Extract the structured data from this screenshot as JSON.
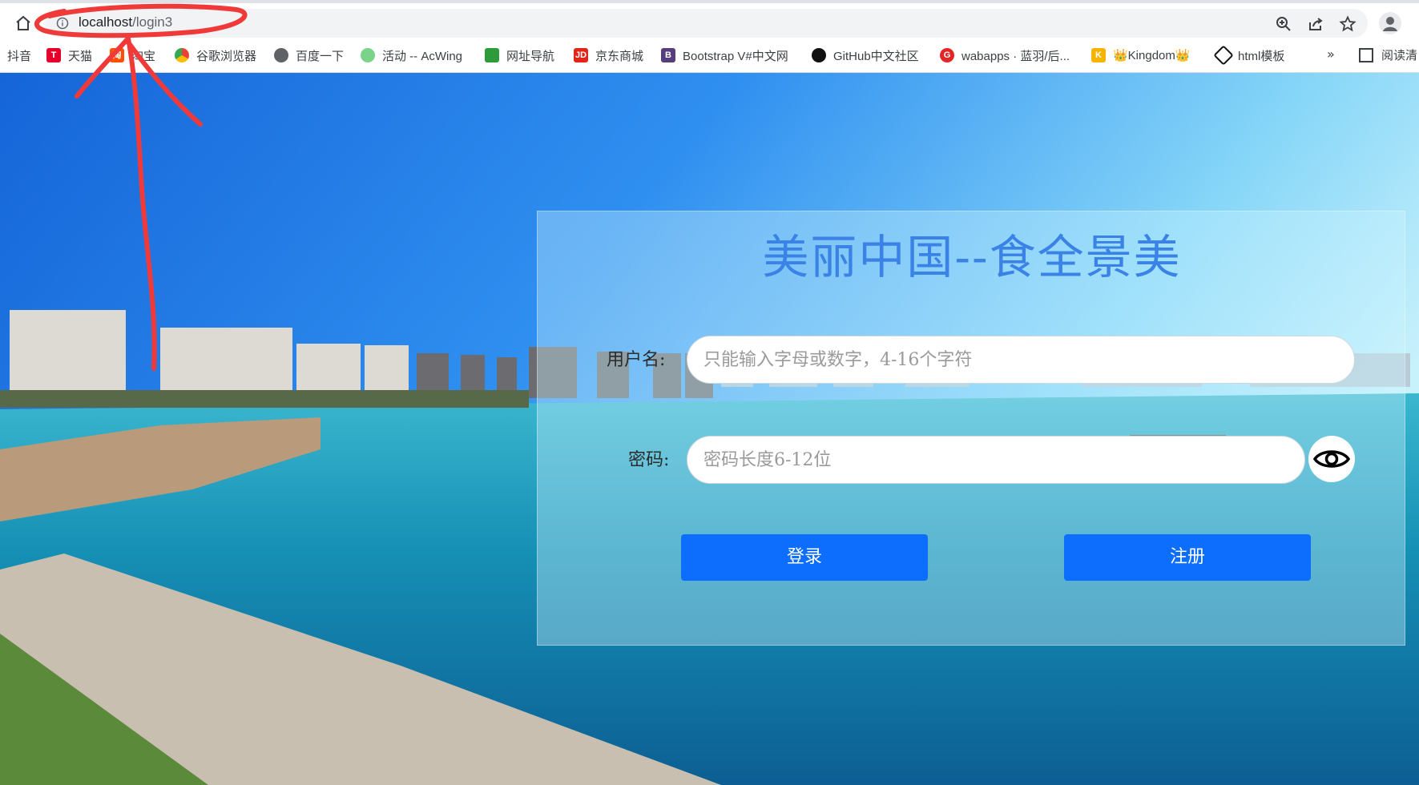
{
  "browser": {
    "url_host": "localhost",
    "url_path": "/login3",
    "omnibox_icons": [
      "zoom-icon",
      "share-icon",
      "star-icon"
    ],
    "bookmarks": [
      {
        "label": "抖音",
        "icon": "douyin-icon",
        "color": "#111111"
      },
      {
        "label": "天猫",
        "icon": "tmall-icon",
        "color": "#e4002b"
      },
      {
        "label": "淘宝",
        "icon": "taobao-icon",
        "color": "#ff5000"
      },
      {
        "label": "谷歌浏览器",
        "icon": "chrome-icon",
        "color": "#4285f4"
      },
      {
        "label": "百度一下",
        "icon": "globe-icon",
        "color": "#5f6368"
      },
      {
        "label": "活动 -- AcWing",
        "icon": "acwing-icon",
        "color": "#34a853"
      },
      {
        "label": "网址导航",
        "icon": "2345-icon",
        "color": "#2e9b3a"
      },
      {
        "label": "京东商城",
        "icon": "jd-icon",
        "color": "#e1251b"
      },
      {
        "label": "Bootstrap V#中文网",
        "icon": "bootstrap-icon",
        "color": "#563d7c"
      },
      {
        "label": "GitHub中文社区",
        "icon": "github-icon",
        "color": "#111111"
      },
      {
        "label": "wabapps · 蓝羽/后...",
        "icon": "wabapps-icon",
        "color": "#e32626"
      },
      {
        "label": "👑Kingdom👑",
        "icon": "kingdom-icon",
        "color": "#f4b400"
      },
      {
        "label": "html模板",
        "icon": "codepen-icon",
        "color": "#111111"
      }
    ],
    "overflow": "»",
    "reading_list": "阅读清"
  },
  "login": {
    "title": "美丽中国--食全景美",
    "username_label": "用户名:",
    "username_placeholder": "只能输入字母或数字，4-16个字符",
    "password_label": "密码:",
    "password_placeholder": "密码长度6-12位",
    "login_button": "登录",
    "register_button": "注册"
  },
  "colors": {
    "title": "#3a82e6",
    "button": "#0d6efd",
    "annotation": "#f03a3a"
  }
}
